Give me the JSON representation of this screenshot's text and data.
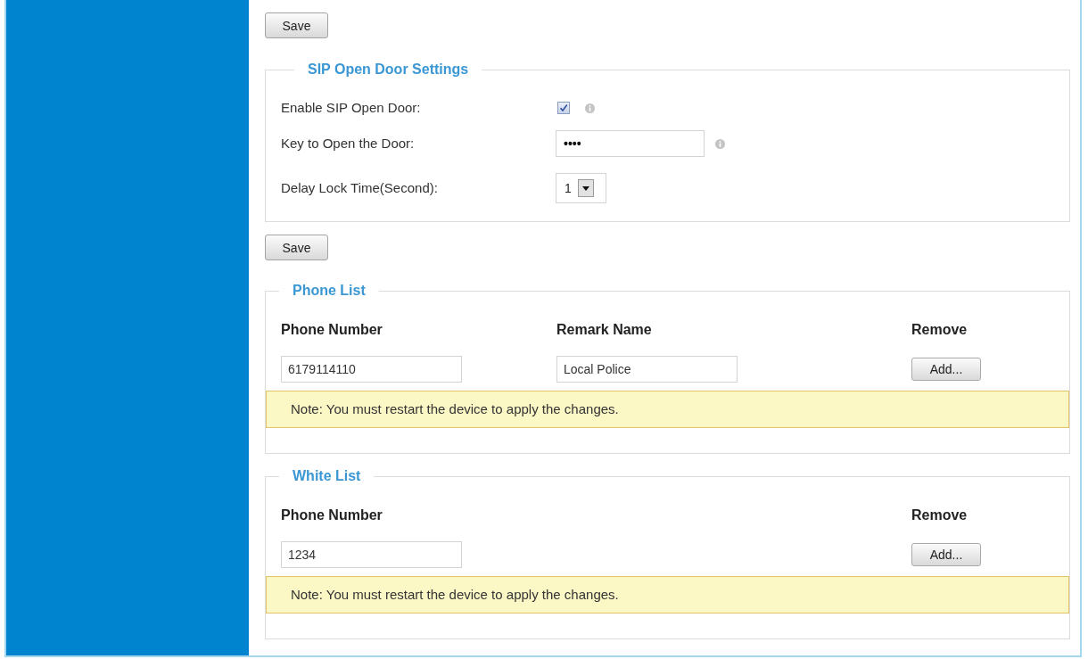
{
  "content": [
    {
      "kind": "button",
      "label": "Save"
    },
    {
      "kind": "settings",
      "title": "SIP Open Door Settings",
      "fields": [
        {
          "kind": "checkbox",
          "label": "Enable SIP Open Door:",
          "checked": true,
          "info": true
        },
        {
          "kind": "password",
          "label": "Key to Open the Door:",
          "value": "••••",
          "info": true
        },
        {
          "kind": "select",
          "label": "Delay Lock Time(Second):",
          "value": "1",
          "info": false
        }
      ]
    },
    {
      "kind": "button",
      "label": "Save"
    },
    {
      "kind": "list",
      "title": "Phone List",
      "columns": [
        {
          "kind": "text",
          "label": "Phone Number"
        },
        {
          "kind": "text",
          "label": "Remark Name"
        },
        {
          "kind": "action",
          "label": "Remove"
        }
      ],
      "rows": [
        {
          "values": [
            "6179114110",
            "Local Police"
          ],
          "button": "Add..."
        }
      ],
      "note": "Note: You must restart the device to apply the changes."
    },
    {
      "kind": "list",
      "title": "White List",
      "columns": [
        {
          "kind": "text",
          "label": "Phone Number"
        },
        {
          "kind": "action",
          "label": "Remove"
        }
      ],
      "rows": [
        {
          "values": [
            "1234"
          ],
          "button": "Add..."
        }
      ],
      "note": "Note: You must restart the device to apply the changes."
    }
  ]
}
